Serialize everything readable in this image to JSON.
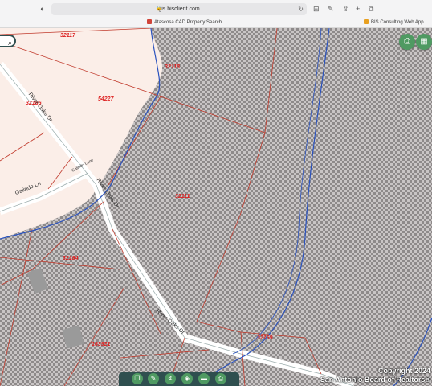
{
  "browser": {
    "url": "gis.bisclient.com",
    "tabs": [
      {
        "title": "Atascosa CAD Property Search",
        "color": "#d0453a"
      },
      {
        "title": "BIS Consulting Web App",
        "color": "#e8a020"
      }
    ]
  },
  "map": {
    "parcels": [
      {
        "id": "32117"
      },
      {
        "id": "32118"
      },
      {
        "id": "54227"
      },
      {
        "id": "32186"
      },
      {
        "id": "32111"
      },
      {
        "id": "32184"
      },
      {
        "id": "163921"
      },
      {
        "id": "32169"
      }
    ],
    "streets": [
      {
        "name": "River Oaks Dr"
      },
      {
        "name": "Galindo Ln"
      },
      {
        "name": "Galindo Lane"
      },
      {
        "name": "River Oaks Dr"
      },
      {
        "name": "River Oaks Dr"
      }
    ],
    "colors": {
      "parcel_line": "#c0392b",
      "river": "#2a52be",
      "floodplain": "#a9a9a9"
    }
  },
  "toolbar": {
    "icons": [
      "bookmark-icon",
      "pencil-icon",
      "route-icon",
      "layers-icon",
      "ruler-icon",
      "print-icon"
    ]
  },
  "watermark": {
    "line1": "Copyright 2024",
    "line2": "San Antonio Board of Realtors®"
  }
}
